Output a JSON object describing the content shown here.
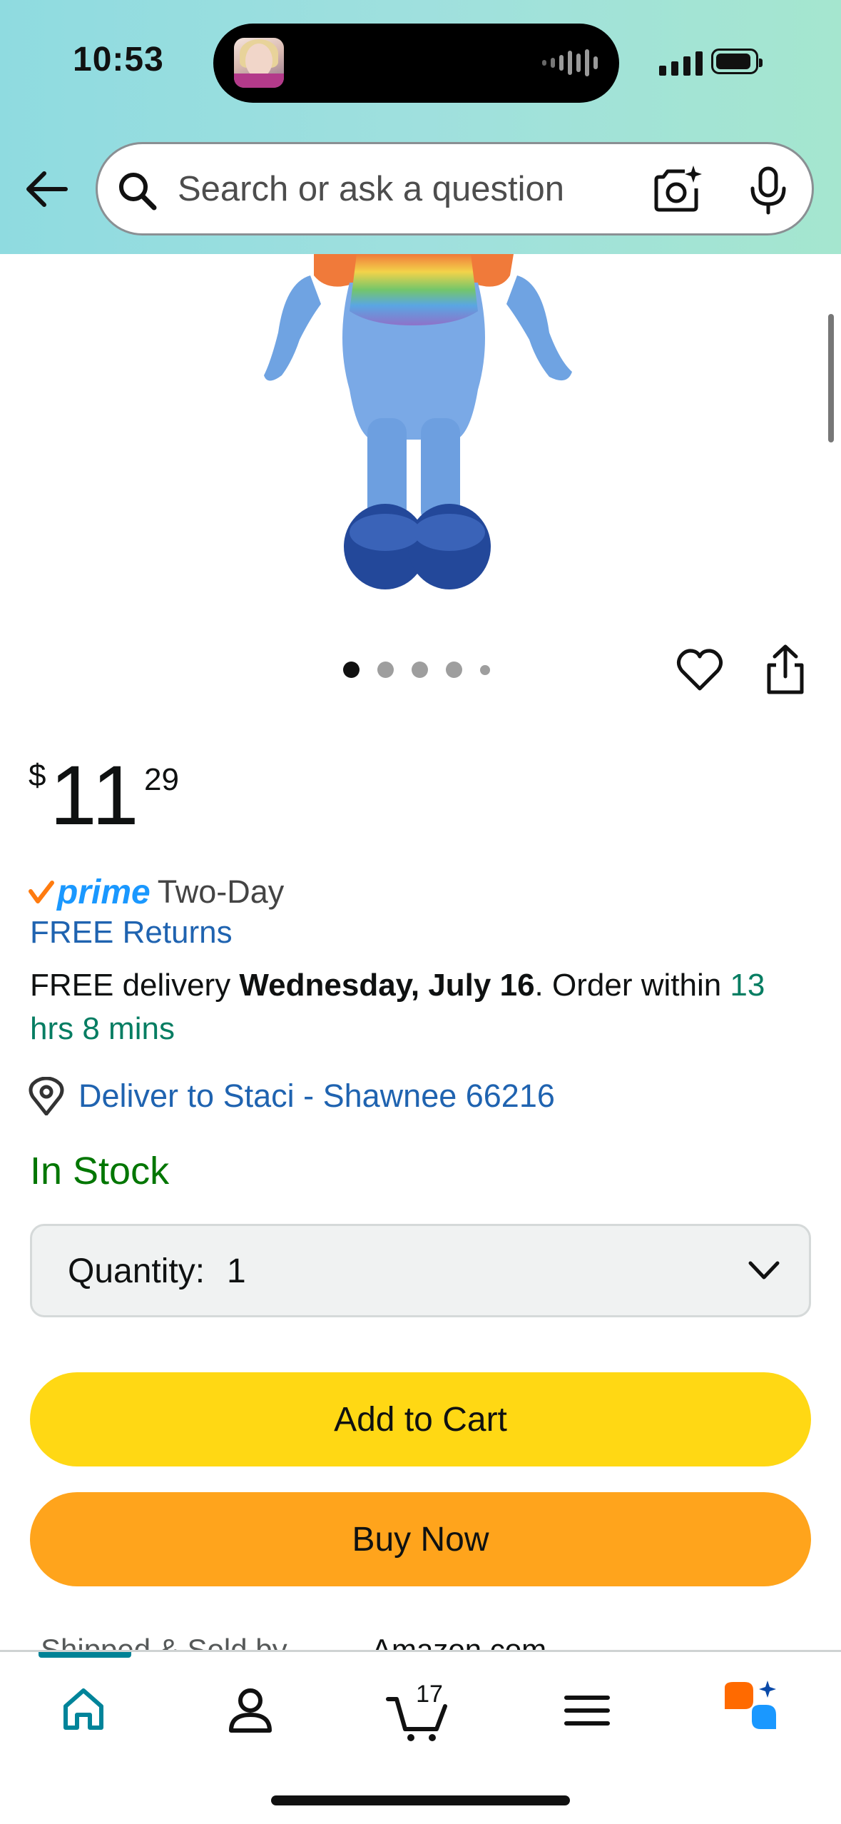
{
  "status_bar": {
    "time": "10:53"
  },
  "search": {
    "placeholder": "Search or ask a question"
  },
  "product": {
    "image_description_icon": "plush-toy-image",
    "carousel_dots": 5,
    "active_dot": 1
  },
  "price": {
    "symbol": "$",
    "whole": "11",
    "fraction": "29"
  },
  "prime": {
    "logo": "prime",
    "speed": "Two-Day"
  },
  "returns": {
    "label": "FREE Returns"
  },
  "delivery": {
    "prefix": "FREE delivery ",
    "date": "Wednesday, July 16",
    "middle": ". Order within ",
    "countdown": "13 hrs 8 mins"
  },
  "deliver_to": {
    "label": "Deliver to Staci - Shawnee 66216"
  },
  "stock": {
    "status": "In Stock"
  },
  "quantity": {
    "label": "Quantity:",
    "value": "1"
  },
  "buttons": {
    "add_to_cart": "Add to Cart",
    "buy_now": "Buy Now"
  },
  "shipped": {
    "label": "Shipped & Sold by",
    "value": "Amazon.com"
  },
  "tabbar": {
    "cart_count": "17",
    "items": [
      "home-icon",
      "account-icon",
      "cart-icon",
      "menu-icon",
      "rufus-ai-icon"
    ]
  },
  "colors": {
    "header_gradient_start": "#8fdbe0",
    "header_gradient_end": "#a5e6cf",
    "link_blue": "#1f63b0",
    "stock_green": "#007600",
    "countdown_green": "#067d62",
    "cart_button": "#ffd814",
    "buy_button": "#ffa41c",
    "tab_indicator": "#008296",
    "prime_blue": "#1a98ff"
  }
}
